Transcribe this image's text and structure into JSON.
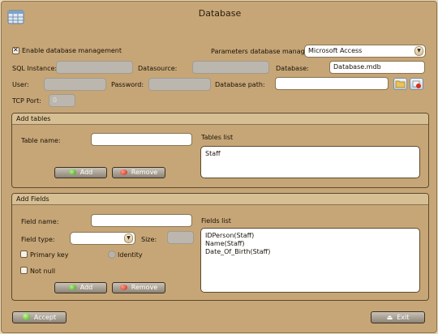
{
  "window": {
    "title": "Database"
  },
  "top": {
    "enable_label": "Enable database management",
    "enable_checked": true,
    "param_manager_label": "Parameters database manager:",
    "param_manager_value": "Microsoft Access",
    "sql_instance_label": "SQL Instance:",
    "datasource_label": "Datasource:",
    "database_label": "Database:",
    "database_value": "Database.mdb",
    "user_label": "User:",
    "password_label": "Password:",
    "database_path_label": "Database path:",
    "database_path_value": "",
    "tcp_port_label": "TCP Port:",
    "tcp_port_value": "0"
  },
  "add_tables": {
    "header": "Add tables",
    "table_name_label": "Table name:",
    "table_name_value": "",
    "tables_list_label": "Tables list",
    "tables": [
      "Staff"
    ],
    "add_label": "Add",
    "remove_label": "Remove"
  },
  "add_fields": {
    "header": "Add Fields",
    "field_name_label": "Field name:",
    "field_name_value": "",
    "field_type_label": "Field type:",
    "field_type_value": "",
    "size_label": "Size:",
    "primary_key_label": "Primary key",
    "identity_label": "Identity",
    "not_null_label": "Not null",
    "fields_list_label": "Fields list",
    "fields": [
      "IDPerson(Staff)",
      "Name(Staff)",
      "Date_Of_Birth(Staff)"
    ],
    "add_label": "Add",
    "remove_label": "Remove"
  },
  "footer": {
    "accept_label": "Accept",
    "exit_label": "Exit"
  }
}
